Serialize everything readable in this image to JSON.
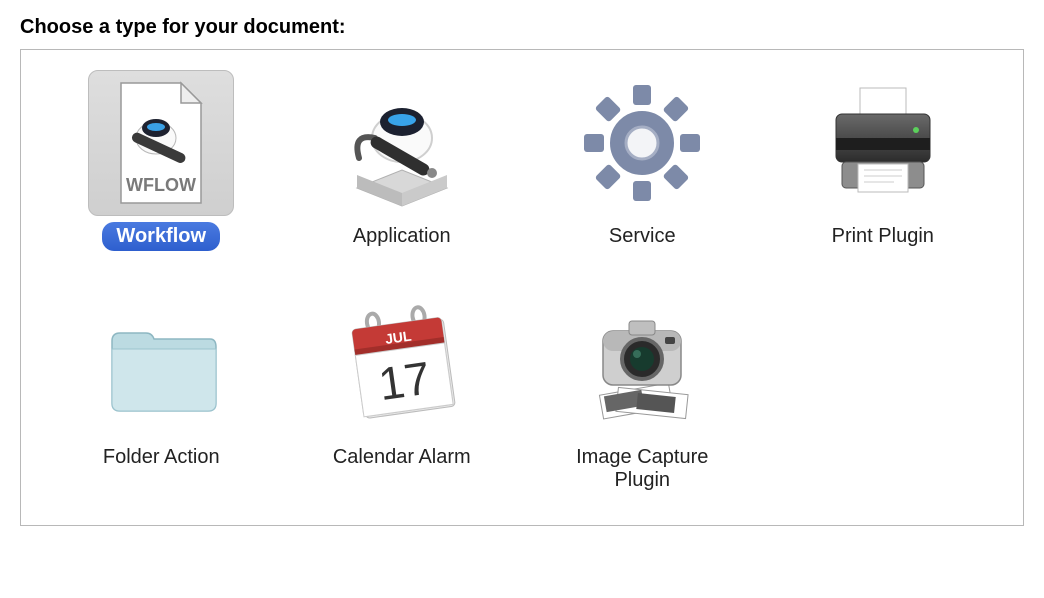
{
  "title": "Choose a type for your document:",
  "items": [
    {
      "label": "Workflow",
      "icon": "workflow",
      "selected": true
    },
    {
      "label": "Application",
      "icon": "application",
      "selected": false
    },
    {
      "label": "Service",
      "icon": "service",
      "selected": false
    },
    {
      "label": "Print Plugin",
      "icon": "print-plugin",
      "selected": false
    },
    {
      "label": "Folder Action",
      "icon": "folder-action",
      "selected": false
    },
    {
      "label": "Calendar Alarm",
      "icon": "calendar-alarm",
      "selected": false
    },
    {
      "label": "Image Capture Plugin",
      "icon": "image-capture-plugin",
      "selected": false
    }
  ]
}
